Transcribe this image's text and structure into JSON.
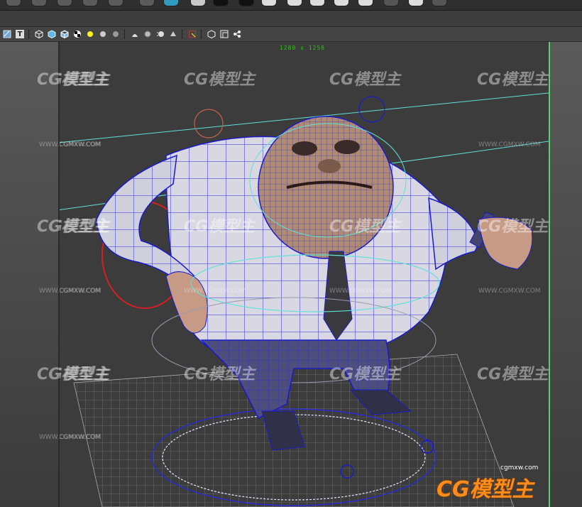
{
  "viewport": {
    "resolution_label": "1280 x 1258"
  },
  "toolbar": {
    "icons": [
      "uv-editor-icon",
      "text-tool-icon",
      "wireframe-cube-icon",
      "smooth-shade-cube-icon",
      "textured-cube-icon",
      "checker-icon",
      "default-light-icon",
      "all-lights-icon",
      "sphere-icon",
      "shadow-icon",
      "ambient-occlusion-icon",
      "motion-blur-icon",
      "anti-alias-icon",
      "grid-select-icon",
      "isolate-cube-icon",
      "panel-layout-icon",
      "graph-icon"
    ],
    "text_icon_label": "T"
  },
  "watermarks": {
    "brand_text": "CG模型主",
    "url_text": "WWW.CGMXW.COM",
    "logo_url_text": "cgmxw.com",
    "logo_text": "CG模型主"
  },
  "colors": {
    "viewport_bg": "#3c3c3c",
    "resolution_green": "#1fd000",
    "wire_blue": "#1b1bc9",
    "control_cyan": "#5fe0d8",
    "logo_orange": "#ff8c1a"
  }
}
